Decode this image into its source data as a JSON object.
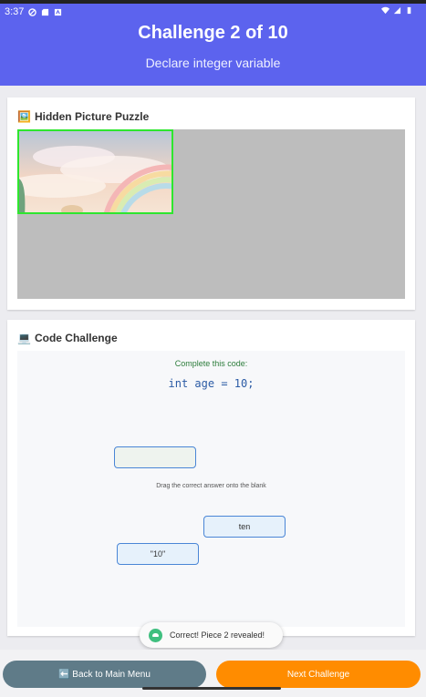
{
  "status_bar": {
    "time": "3:37"
  },
  "header": {
    "title": "Challenge 2 of 10",
    "subtitle": "Declare integer variable"
  },
  "puzzle": {
    "icon": "🖼️",
    "title": "Hidden Picture Puzzle",
    "revealed_pieces": 1
  },
  "code_challenge": {
    "icon": "💻",
    "title": "Code Challenge",
    "prompt": "Complete this code:",
    "code": "int age = 10;",
    "instruction": "Drag the correct answer onto the blank",
    "options": [
      "ten",
      "\"10\""
    ]
  },
  "toast": {
    "message": "Correct! Piece 2 revealed!"
  },
  "bottom": {
    "back_label": "⬅️ Back to Main Menu",
    "next_label": "Next Challenge"
  },
  "colors": {
    "header": "#5c63ee",
    "next_button": "#ff8c00",
    "back_button": "#5f7b88",
    "piece_border": "#2ee62e"
  }
}
